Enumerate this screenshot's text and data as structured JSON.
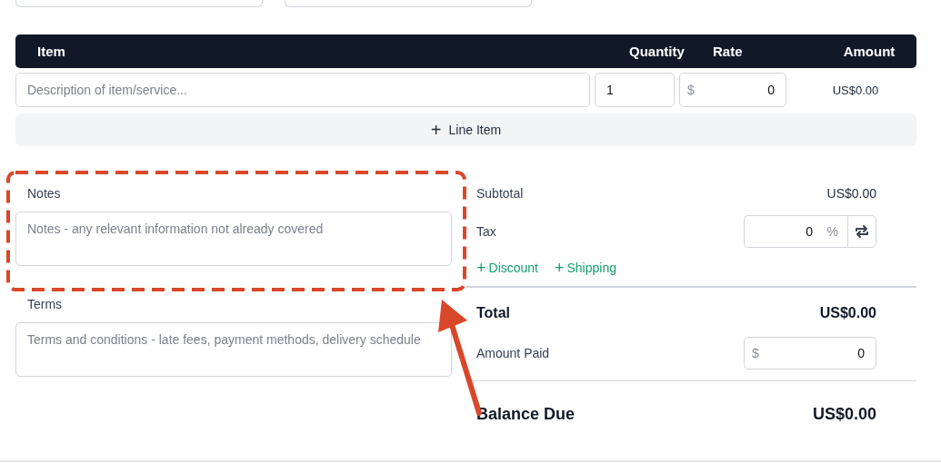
{
  "table": {
    "columns": [
      "Item",
      "Quantity",
      "Rate",
      "Amount"
    ],
    "rows": [
      {
        "description_placeholder": "Description of item/service...",
        "quantity": "1",
        "currency": "$",
        "rate": "0",
        "amount": "US$0.00"
      }
    ],
    "add_button": {
      "icon": "+",
      "label": "Line Item"
    }
  },
  "notes": {
    "label": "Notes",
    "placeholder": "Notes - any relevant information not already covered"
  },
  "terms": {
    "label": "Terms",
    "placeholder": "Terms and conditions - late fees, payment methods, delivery schedule"
  },
  "summary": {
    "subtotal": {
      "label": "Subtotal",
      "value": "US$0.00"
    },
    "tax": {
      "label": "Tax",
      "value": "0",
      "unit": "%"
    },
    "links": [
      {
        "icon": "+",
        "label": "Discount"
      },
      {
        "icon": "+",
        "label": "Shipping"
      }
    ],
    "total": {
      "label": "Total",
      "value": "US$0.00"
    },
    "amount_paid": {
      "label": "Amount Paid",
      "currency": "$",
      "value": "0"
    },
    "balance_due": {
      "label": "Balance Due",
      "value": "US$0.00"
    }
  }
}
